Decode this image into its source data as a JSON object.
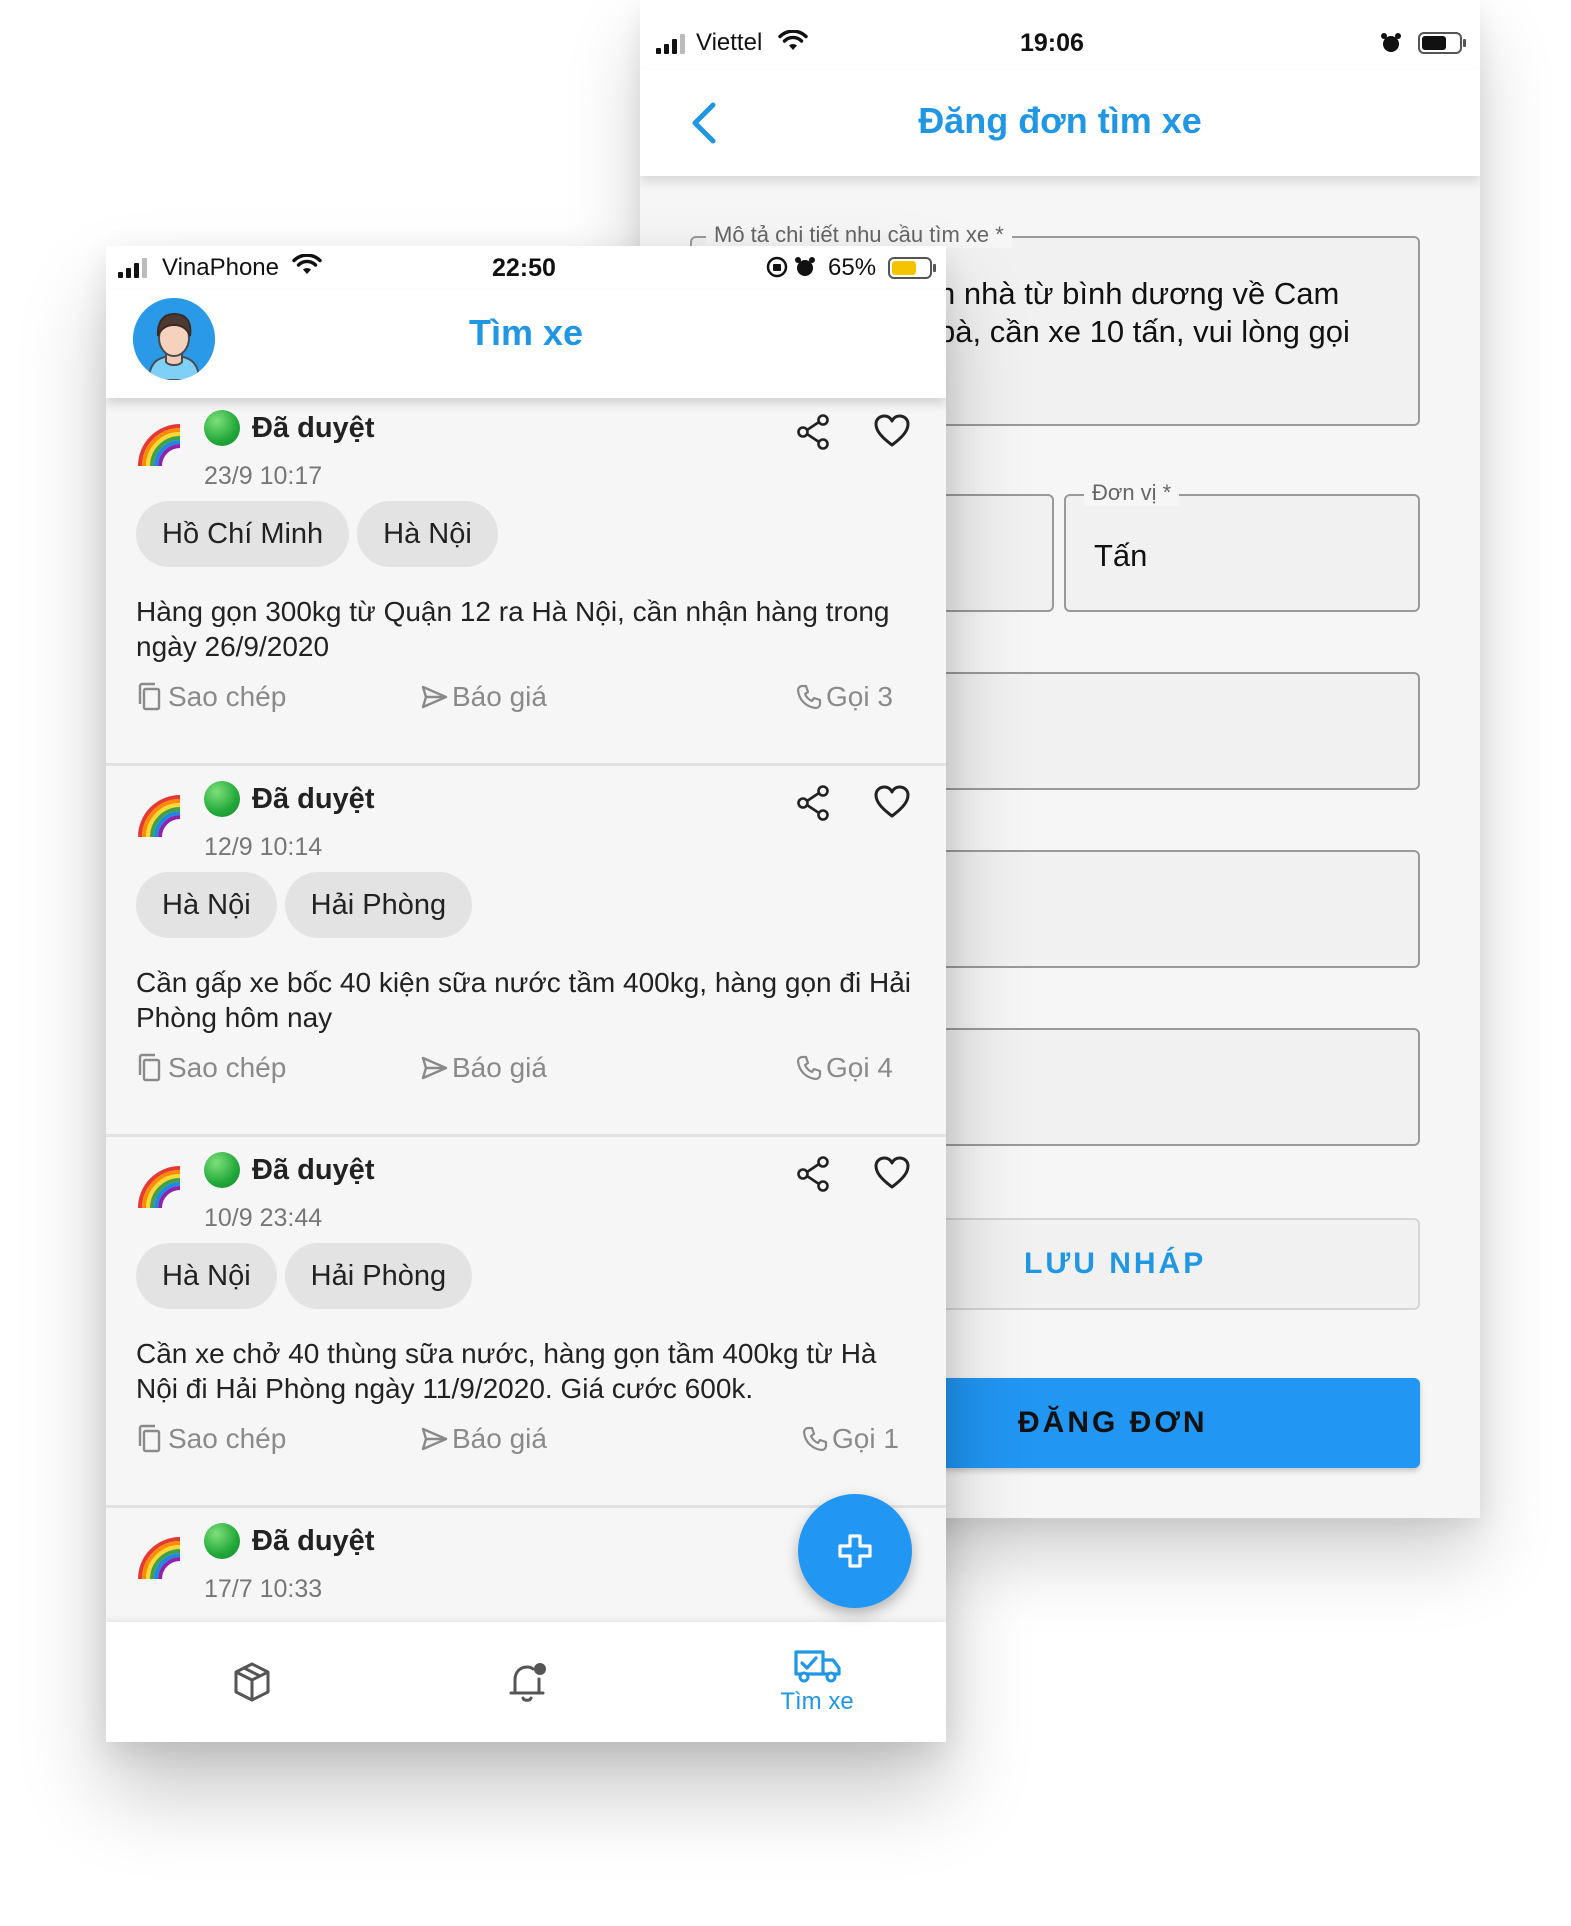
{
  "back_screen": {
    "status_bar": {
      "carrier": "Viettel",
      "time": "19:06"
    },
    "title": "Đăng đơn tìm xe",
    "description_field": {
      "label": "Mô tả chi tiết nhu cầu tìm xe *",
      "value_line1": "n nhà từ bình dương về Cam",
      "value_line2": "bà, cần xe 10 tấn, vui lòng gọi"
    },
    "unit_field": {
      "label": "Đơn vị *",
      "value": "Tấn"
    },
    "draft_button": "LƯU NHÁP",
    "submit_button": "ĐĂNG ĐƠN"
  },
  "front_screen": {
    "status_bar": {
      "carrier": "VinaPhone",
      "time": "22:50",
      "battery_percent": "65%"
    },
    "title": "Tìm xe",
    "posts": [
      {
        "status": "Đã duyệt",
        "date": "23/9 10:17",
        "from": "Hồ Chí Minh",
        "to": "Hà Nội",
        "description": "Hàng gọn 300kg từ Quận 12 ra Hà Nội, cần nhận hàng trong ngày 26/9/2020",
        "copy_label": "Sao chép",
        "quote_label": "Báo giá",
        "call_label": "Gọi 3"
      },
      {
        "status": "Đã duyệt",
        "date": "12/9 10:14",
        "from": "Hà Nội",
        "to": "Hải Phòng",
        "description": "Cần gấp xe bốc 40 kiện sữa nước tầm 400kg, hàng gọn đi Hải Phòng hôm nay",
        "copy_label": "Sao chép",
        "quote_label": "Báo giá",
        "call_label": "Gọi 4"
      },
      {
        "status": "Đã duyệt",
        "date": "10/9 23:44",
        "from": "Hà Nội",
        "to": "Hải Phòng",
        "description": "Cần xe chở 40 thùng sữa nước, hàng gọn tầm 400kg từ Hà Nội đi Hải Phòng ngày 11/9/2020. Giá cước 600k.",
        "copy_label": "Sao chép",
        "quote_label": "Báo giá",
        "call_label": "Gọi 1"
      },
      {
        "status": "Đã duyệt",
        "date": "17/7 10:33"
      }
    ],
    "bottom_nav": {
      "active_label": "Tìm xe"
    }
  },
  "colors": {
    "accent": "#2196e3",
    "button_blue": "#2196f3",
    "approved_green": "#22a83a",
    "battery_yellow": "#f5c400"
  },
  "icons": [
    "back-arrow-icon",
    "share-icon",
    "heart-icon",
    "copy-icon",
    "send-icon",
    "phone-icon",
    "plus-icon",
    "box-icon",
    "bell-icon",
    "truck-icon",
    "rainbow-icon",
    "wifi-icon",
    "alarm-icon",
    "rotation-lock-icon"
  ]
}
